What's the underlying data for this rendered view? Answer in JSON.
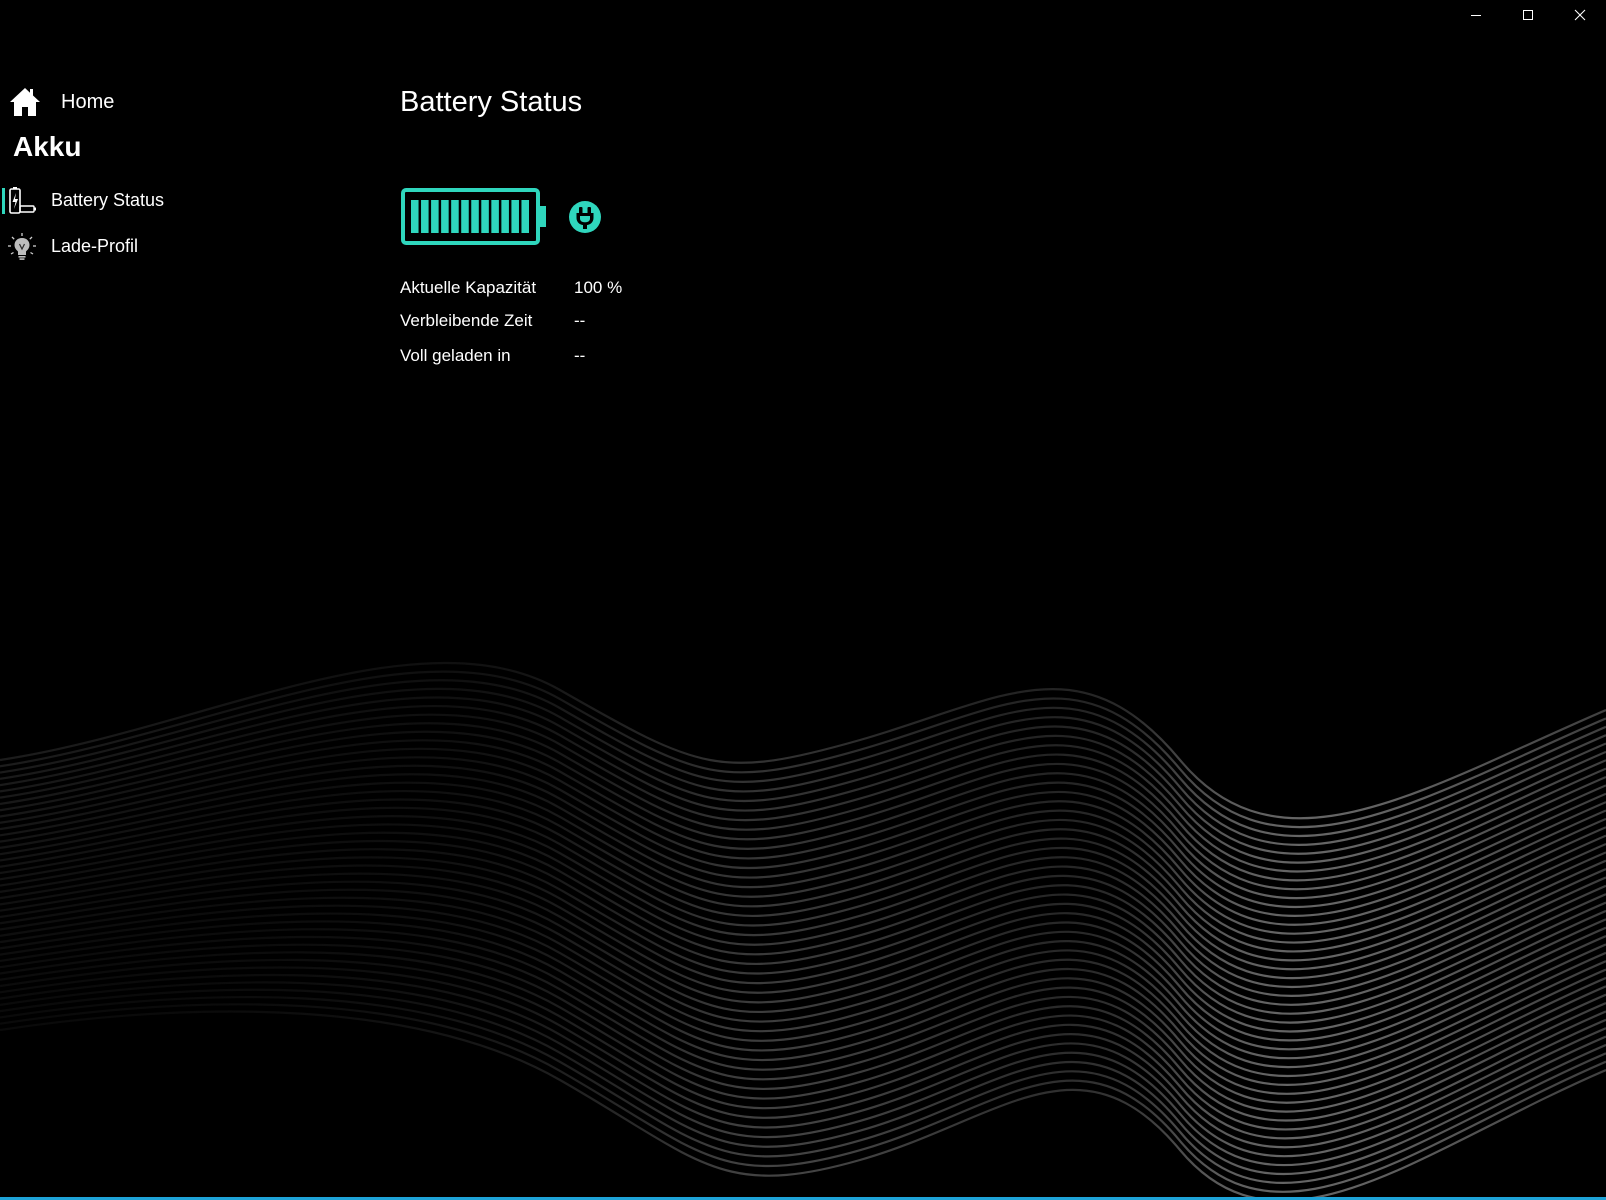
{
  "window": {
    "controls": {
      "minimize": "minimize-icon",
      "maximize": "maximize-icon",
      "close": "close-icon"
    }
  },
  "sidebar": {
    "home": {
      "label": "Home",
      "icon": "home-icon"
    },
    "section_title": "Akku",
    "items": [
      {
        "label": "Battery Status",
        "icon": "battery-charging-icon",
        "selected": true
      },
      {
        "label": "Lade-Profil",
        "icon": "lightbulb-icon",
        "selected": false
      }
    ]
  },
  "main": {
    "title": "Battery Status",
    "battery": {
      "level_percent": 100,
      "charging": true,
      "icon": "plug-icon"
    },
    "rows": [
      {
        "label": "Aktuelle Kapazität",
        "value": "100 %"
      },
      {
        "label": "Verbleibende Zeit",
        "value": "--"
      },
      {
        "label": "Voll geladen in",
        "value": "--"
      }
    ]
  },
  "colors": {
    "background": "#000000",
    "text": "#ffffff",
    "accent": "#2fd6bd",
    "indicator": "#2fd6bd",
    "bottom_bar": "#1ea3d8",
    "wave": "#d0d0d0"
  }
}
